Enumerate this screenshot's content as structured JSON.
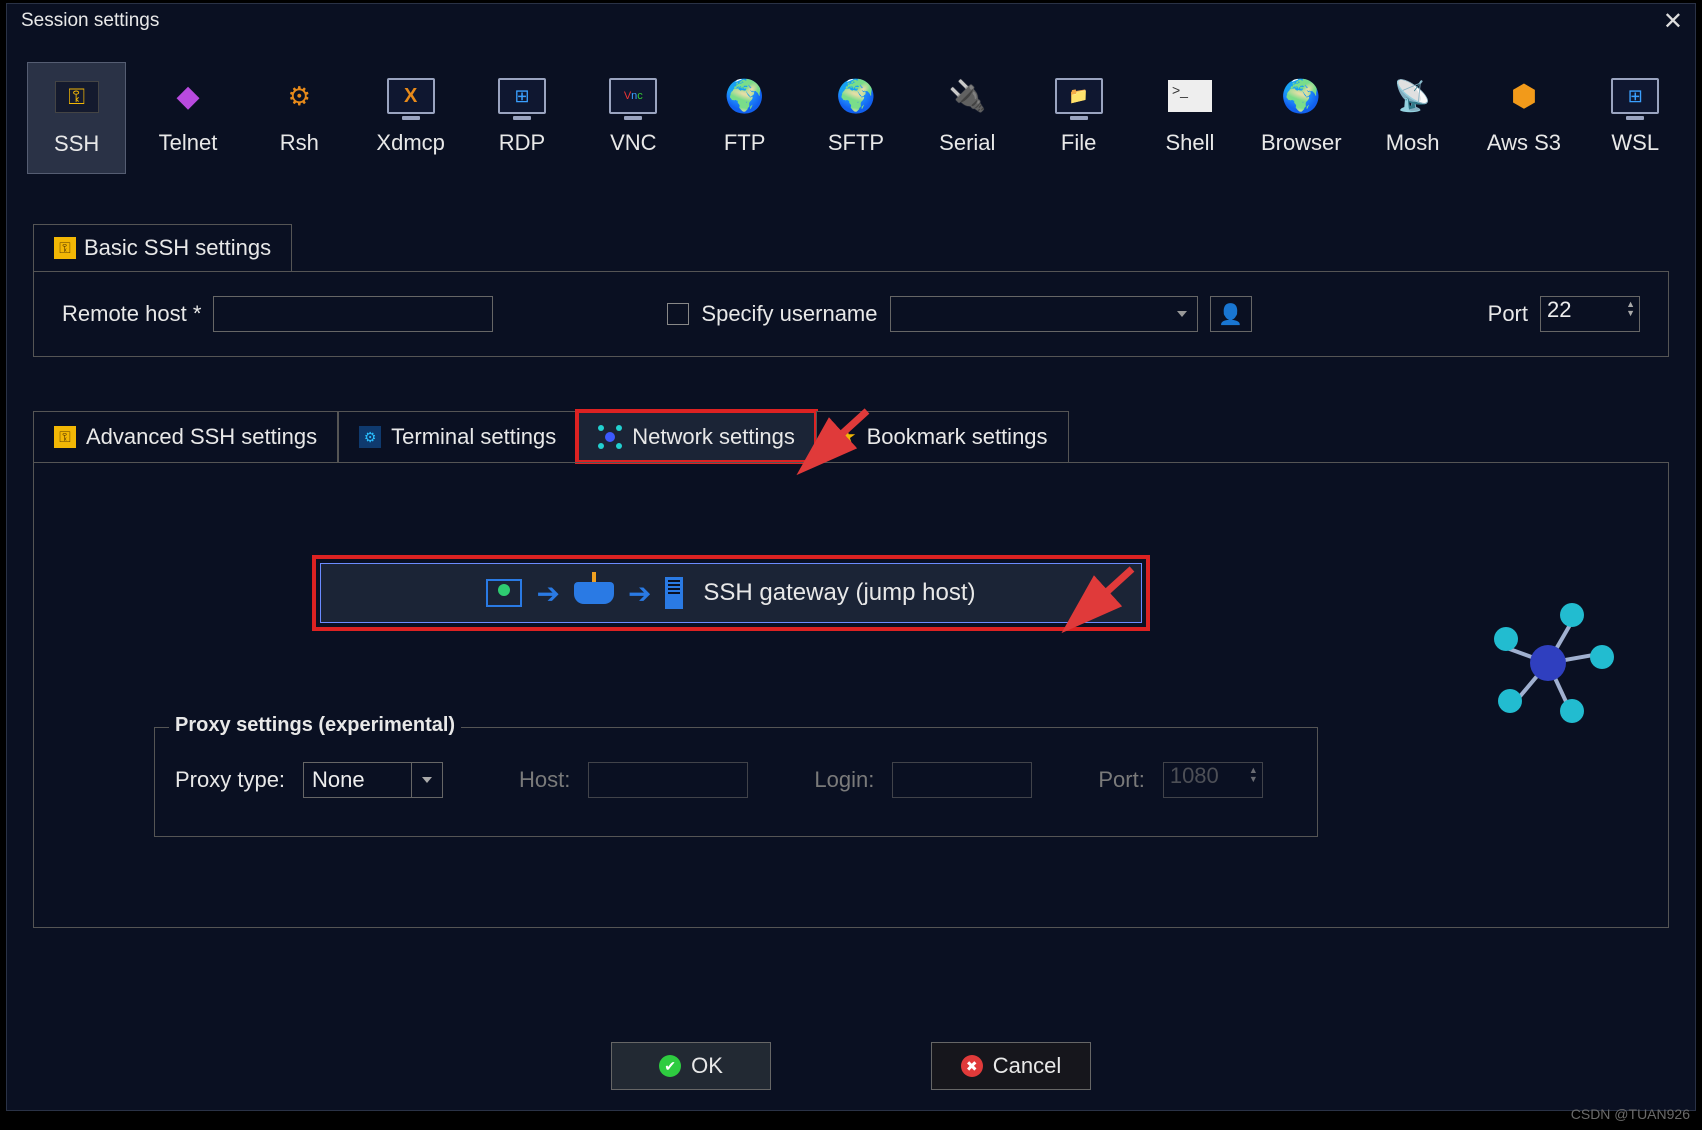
{
  "window": {
    "title": "Session settings"
  },
  "types": {
    "items": [
      {
        "label": "SSH"
      },
      {
        "label": "Telnet"
      },
      {
        "label": "Rsh"
      },
      {
        "label": "Xdmcp"
      },
      {
        "label": "RDP"
      },
      {
        "label": "VNC"
      },
      {
        "label": "FTP"
      },
      {
        "label": "SFTP"
      },
      {
        "label": "Serial"
      },
      {
        "label": "File"
      },
      {
        "label": "Shell"
      },
      {
        "label": "Browser"
      },
      {
        "label": "Mosh"
      },
      {
        "label": "Aws S3"
      },
      {
        "label": "WSL"
      }
    ]
  },
  "basic": {
    "tab_label": "Basic SSH settings",
    "remote_host_label": "Remote host *",
    "remote_host_value": "",
    "specify_username_label": "Specify username",
    "specify_username_checked": false,
    "username_value": "",
    "port_label": "Port",
    "port_value": "22"
  },
  "subtabs": {
    "advanced": "Advanced SSH settings",
    "terminal": "Terminal settings",
    "network": "Network settings",
    "bookmark": "Bookmark settings"
  },
  "network": {
    "gateway_button": "SSH gateway (jump host)",
    "proxy_legend": "Proxy settings (experimental)",
    "proxy_type_label": "Proxy type:",
    "proxy_type_value": "None",
    "host_label": "Host:",
    "host_value": "",
    "login_label": "Login:",
    "login_value": "",
    "port_label": "Port:",
    "port_value": "1080"
  },
  "buttons": {
    "ok": "OK",
    "cancel": "Cancel"
  },
  "watermark": "CSDN @TUAN926"
}
